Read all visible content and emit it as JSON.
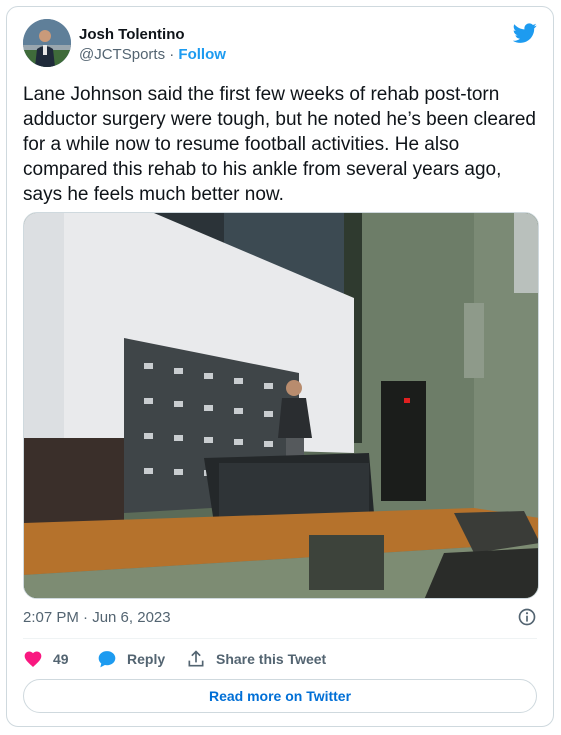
{
  "author": {
    "name": "Josh Tolentino",
    "handle": "@JCTSports",
    "separator": "·",
    "follow_label": "Follow"
  },
  "tweet": {
    "text": "Lane Johnson said the first few weeks of rehab post-torn adductor surgery were tough, but he noted he’s been cleared for a while now to resume football activities. He also compared this rehab to his ankle from several years ago, says he feels much better now.",
    "timestamp": "2:07 PM · Jun 6, 2023"
  },
  "actions": {
    "likes_count": "49",
    "reply_label": "Reply",
    "share_label": "Share this Tweet"
  },
  "footer": {
    "read_more_label": "Read more on Twitter"
  },
  "colors": {
    "twitter_blue": "#1d9bf0",
    "like_red": "#f91880",
    "link_blue": "#006fd6"
  },
  "icons": [
    "twitter-bird-icon",
    "info-icon",
    "heart-icon",
    "reply-bubble-icon",
    "share-icon"
  ]
}
